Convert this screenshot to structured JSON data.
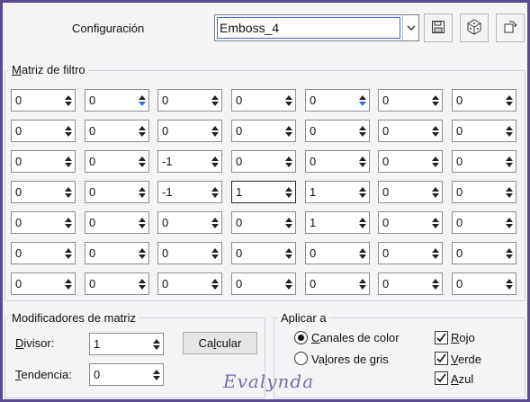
{
  "header": {
    "preset_label": "Configuración",
    "preset_value": "Emboss_4"
  },
  "matrix": {
    "title": "Matriz de filtro",
    "rows": [
      [
        "0",
        "0",
        "0",
        "0",
        "0",
        "0",
        "0"
      ],
      [
        "0",
        "0",
        "0",
        "0",
        "0",
        "0",
        "0"
      ],
      [
        "0",
        "0",
        "-1",
        "0",
        "0",
        "0",
        "0"
      ],
      [
        "0",
        "0",
        "-1",
        "1",
        "1",
        "0",
        "0"
      ],
      [
        "0",
        "0",
        "0",
        "0",
        "1",
        "0",
        "0"
      ],
      [
        "0",
        "0",
        "0",
        "0",
        "0",
        "0",
        "0"
      ],
      [
        "0",
        "0",
        "0",
        "0",
        "0",
        "0",
        "0"
      ]
    ]
  },
  "modifiers": {
    "title": "Modificadores de matriz",
    "divisor_label": "Divisor:",
    "divisor_value": "1",
    "bias_label": "Tendencia:",
    "bias_value": "0",
    "calculate_label": "Calcular"
  },
  "apply": {
    "title": "Aplicar a",
    "channels_label": "Canales de color",
    "gray_label": "Valores de gris",
    "red_label": "Rojo",
    "green_label": "Verde",
    "blue_label": "Azul"
  },
  "watermark": "Evalynda",
  "colors": {
    "frame": "#5b4a8e",
    "focus": "#2f6fd6"
  }
}
